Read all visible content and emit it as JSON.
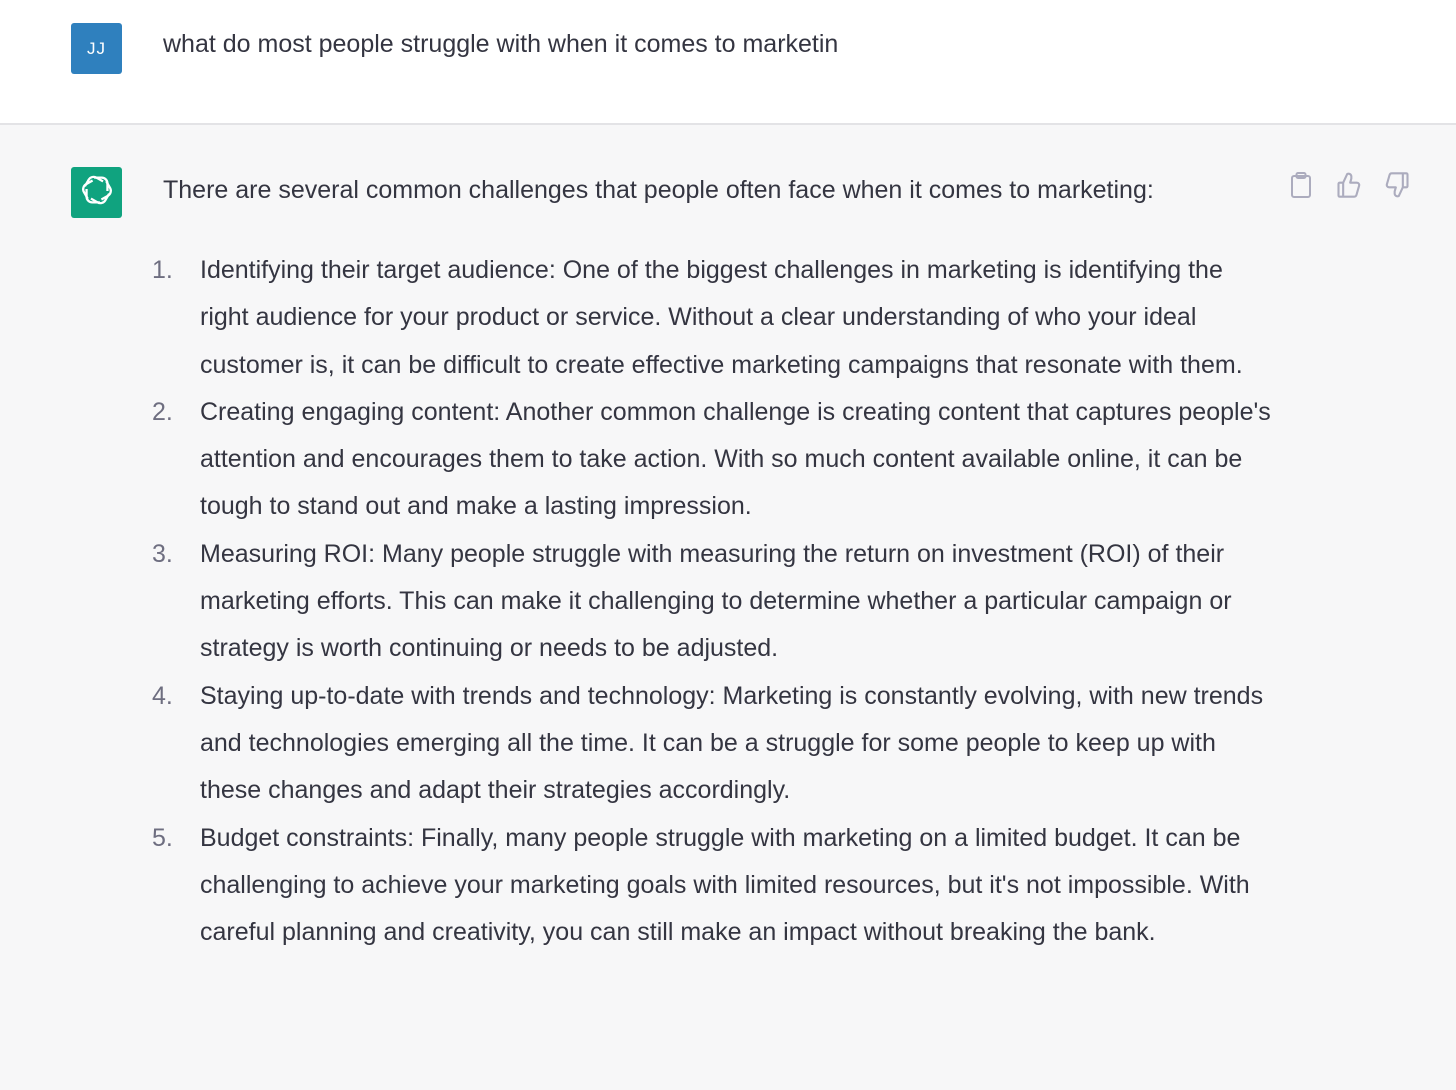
{
  "user_message": {
    "avatar_initials": "JJ",
    "text": "what do most people struggle with when it comes to marketin"
  },
  "assistant_message": {
    "intro": "There are several common challenges that people often face when it comes to marketing:",
    "items": [
      {
        "number": "1.",
        "text": "Identifying their target audience: One of the biggest challenges in marketing is identifying the right audience for your product or service. Without a clear understanding of who your ideal customer is, it can be difficult to create effective marketing campaigns that resonate with them."
      },
      {
        "number": "2.",
        "text": "Creating engaging content: Another common challenge is creating content that captures people's attention and encourages them to take action. With so much content available online, it can be tough to stand out and make a lasting impression."
      },
      {
        "number": "3.",
        "text": "Measuring ROI: Many people struggle with measuring the return on investment (ROI) of their marketing efforts. This can make it challenging to determine whether a particular campaign or strategy is worth continuing or needs to be adjusted."
      },
      {
        "number": "4.",
        "text": "Staying up-to-date with trends and technology: Marketing is constantly evolving, with new trends and technologies emerging all the time. It can be a struggle for some people to keep up with these changes and adapt their strategies accordingly."
      },
      {
        "number": "5.",
        "text": "Budget constraints: Finally, many people struggle with marketing on a limited budget. It can be challenging to achieve your marketing goals with limited resources, but it's not impossible. With careful planning and creativity, you can still make an impact without breaking the bank."
      }
    ]
  },
  "icons": {
    "assistant_avatar": "openai-logo-icon",
    "copy": "clipboard-icon",
    "like": "thumbs-up-icon",
    "dislike": "thumbs-down-icon"
  },
  "colors": {
    "user_avatar": "#2f80be",
    "assistant_avatar": "#10a37f",
    "text": "#343541",
    "assistant_bg": "#f7f7f8"
  }
}
